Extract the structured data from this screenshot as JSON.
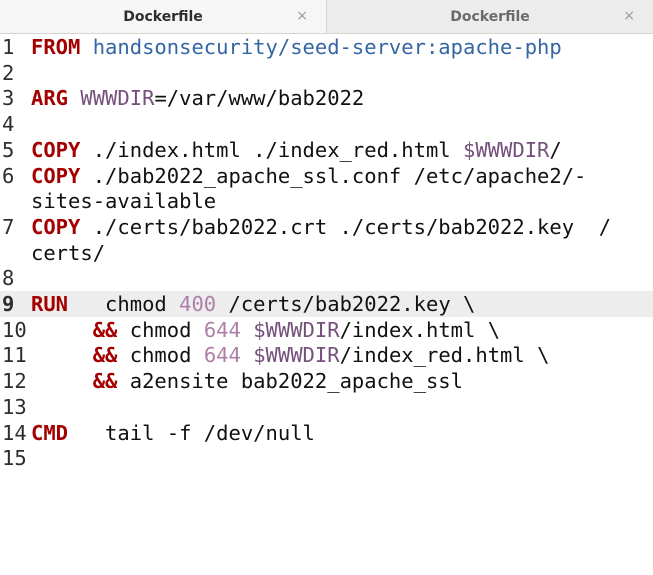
{
  "tabs": [
    {
      "title": "Dockerfile",
      "close": "×"
    },
    {
      "title": "Dockerfile",
      "close": "×"
    }
  ],
  "lines": [
    {
      "n": "1",
      "segs": [
        [
          "kw",
          "FROM"
        ],
        [
          "",
          " "
        ],
        [
          "img",
          "handsonsecurity/seed-server:apache-php"
        ]
      ]
    },
    {
      "n": "2",
      "segs": []
    },
    {
      "n": "3",
      "segs": [
        [
          "kw",
          "ARG"
        ],
        [
          "",
          " "
        ],
        [
          "var",
          "WWWDIR"
        ],
        [
          "",
          "=/var/www/bab2022"
        ]
      ]
    },
    {
      "n": "4",
      "segs": []
    },
    {
      "n": "5",
      "segs": [
        [
          "kw",
          "COPY"
        ],
        [
          "",
          " ./index.html ./index_red.html "
        ],
        [
          "var",
          "$WWWDIR"
        ],
        [
          "",
          "/"
        ]
      ]
    },
    {
      "n": "6",
      "segs": [
        [
          "kw",
          "COPY"
        ],
        [
          "",
          " ./bab2022_apache_ssl.conf /etc/apache2/-"
        ]
      ]
    },
    {
      "n": "",
      "segs": [
        [
          "",
          "sites-available"
        ]
      ]
    },
    {
      "n": "7",
      "segs": [
        [
          "kw",
          "COPY"
        ],
        [
          "",
          " ./certs/bab2022.crt ./certs/bab2022.key  /"
        ]
      ]
    },
    {
      "n": "",
      "segs": [
        [
          "",
          "certs/"
        ]
      ]
    },
    {
      "n": "8",
      "segs": []
    },
    {
      "n": "9",
      "segs": [
        [
          "kw",
          "RUN"
        ],
        [
          "",
          "   chmod "
        ],
        [
          "num",
          "400"
        ],
        [
          "",
          " /certs/bab2022.key \\"
        ]
      ]
    },
    {
      "n": "10",
      "segs": [
        [
          "",
          "     "
        ],
        [
          "kw",
          "&&"
        ],
        [
          "",
          " chmod "
        ],
        [
          "num",
          "644"
        ],
        [
          "",
          " "
        ],
        [
          "var",
          "$WWWDIR"
        ],
        [
          "",
          "/index.html \\"
        ]
      ]
    },
    {
      "n": "11",
      "segs": [
        [
          "",
          "     "
        ],
        [
          "kw",
          "&&"
        ],
        [
          "",
          " chmod "
        ],
        [
          "num",
          "644"
        ],
        [
          "",
          " "
        ],
        [
          "var",
          "$WWWDIR"
        ],
        [
          "",
          "/index_red.html \\"
        ]
      ]
    },
    {
      "n": "12",
      "segs": [
        [
          "",
          "     "
        ],
        [
          "kw",
          "&&"
        ],
        [
          "",
          " a2ensite bab2022_apache_ssl"
        ]
      ]
    },
    {
      "n": "13",
      "segs": []
    },
    {
      "n": "14",
      "segs": [
        [
          "kw",
          "CMD"
        ],
        [
          "",
          "   tail -f /dev/null"
        ]
      ]
    },
    {
      "n": "15",
      "segs": []
    }
  ],
  "current_line": "9"
}
